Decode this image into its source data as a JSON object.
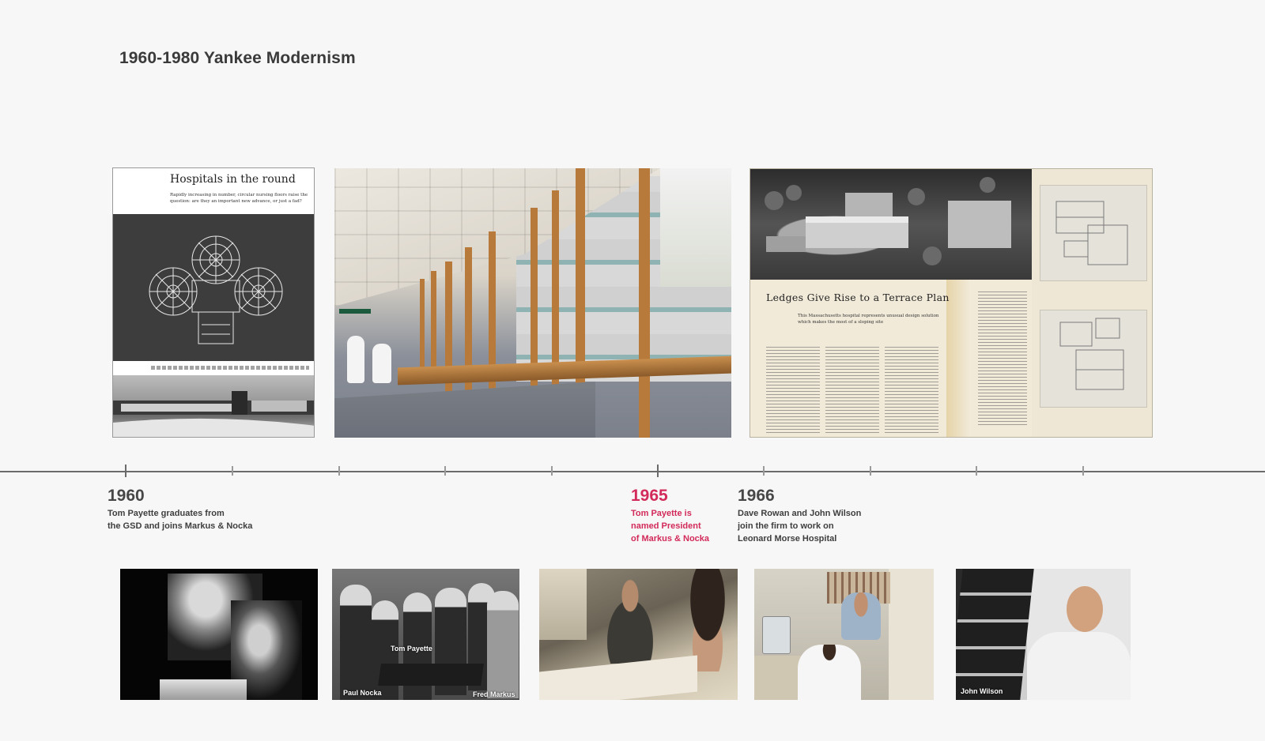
{
  "page": {
    "title": "1960-1980 Yankee Modernism"
  },
  "top_images": {
    "magazine_left": {
      "headline": "Hospitals in the round",
      "subhead": "Rapidly increasing in number, circular nursing floors raise the question: are they an important new advance, or just a fad?"
    },
    "magazine_right": {
      "headline": "Ledges Give Rise to a Terrace Plan",
      "subhead": "This Massachusetts hospital represents unusual design solution which makes the most of a sloping site"
    }
  },
  "timeline": {
    "events": [
      {
        "year": "1960",
        "description": "Tom Payette graduates from\nthe GSD and joins Markus & Nocka",
        "highlighted": false
      },
      {
        "year": "1965",
        "description": "Tom Payette is\nnamed President\nof Markus & Nocka",
        "highlighted": true
      },
      {
        "year": "1966",
        "description": "Dave Rowan and John Wilson\njoin the firm to work on\nLeonard Morse Hospital",
        "highlighted": false
      }
    ],
    "colors": {
      "line": "#6b6b6b",
      "highlight": "#d22a5a",
      "text": "#3e3e3e"
    }
  },
  "bottom_photos": {
    "group_photo_labels": {
      "center": "Tom Payette",
      "left": "Paul Nocka",
      "right": "Fred Markus"
    },
    "last_photo_label": "John Wilson"
  }
}
